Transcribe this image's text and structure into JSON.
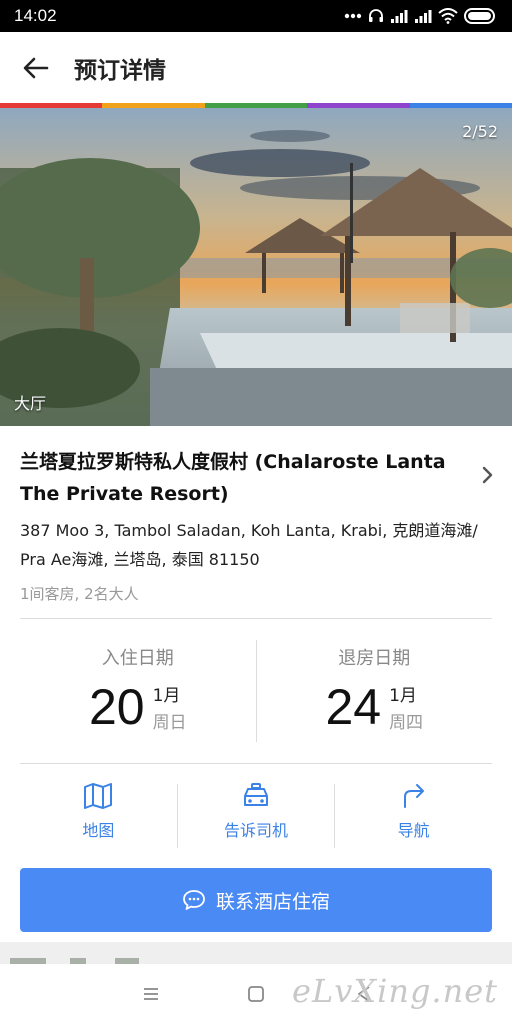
{
  "status": {
    "time": "14:02"
  },
  "header": {
    "title": "预订详情"
  },
  "rainbow_colors": [
    "#e53935",
    "#f0a21a",
    "#43a047",
    "#8e44cc",
    "#3b82e6"
  ],
  "photo": {
    "counter": "2/52",
    "caption": "大厅"
  },
  "hotel": {
    "name": "兰塔夏拉罗斯特私人度假村 (Chalaroste Lanta The Private Resort)",
    "address": "387 Moo 3, Tambol Saladan, Koh Lanta, Krabi, 克朗道海滩/ Pra Ae海滩, 兰塔岛, 泰国 81150",
    "rooms": "1间客房, 2名大人"
  },
  "dates": {
    "checkin": {
      "label": "入住日期",
      "day": "20",
      "month": "1月",
      "weekday": "周日"
    },
    "checkout": {
      "label": "退房日期",
      "day": "24",
      "month": "1月",
      "weekday": "周四"
    }
  },
  "actions": [
    {
      "label": "地图",
      "icon": "map-icon"
    },
    {
      "label": "告诉司机",
      "icon": "taxi-icon"
    },
    {
      "label": "导航",
      "icon": "navigation-arrow-icon"
    }
  ],
  "contact": {
    "label": "联系酒店住宿",
    "icon": "chat-bubble-icon"
  },
  "watermark": "eLvXing.net",
  "colors": {
    "accent": "#4a8af4",
    "action_text": "#3b82e6"
  }
}
